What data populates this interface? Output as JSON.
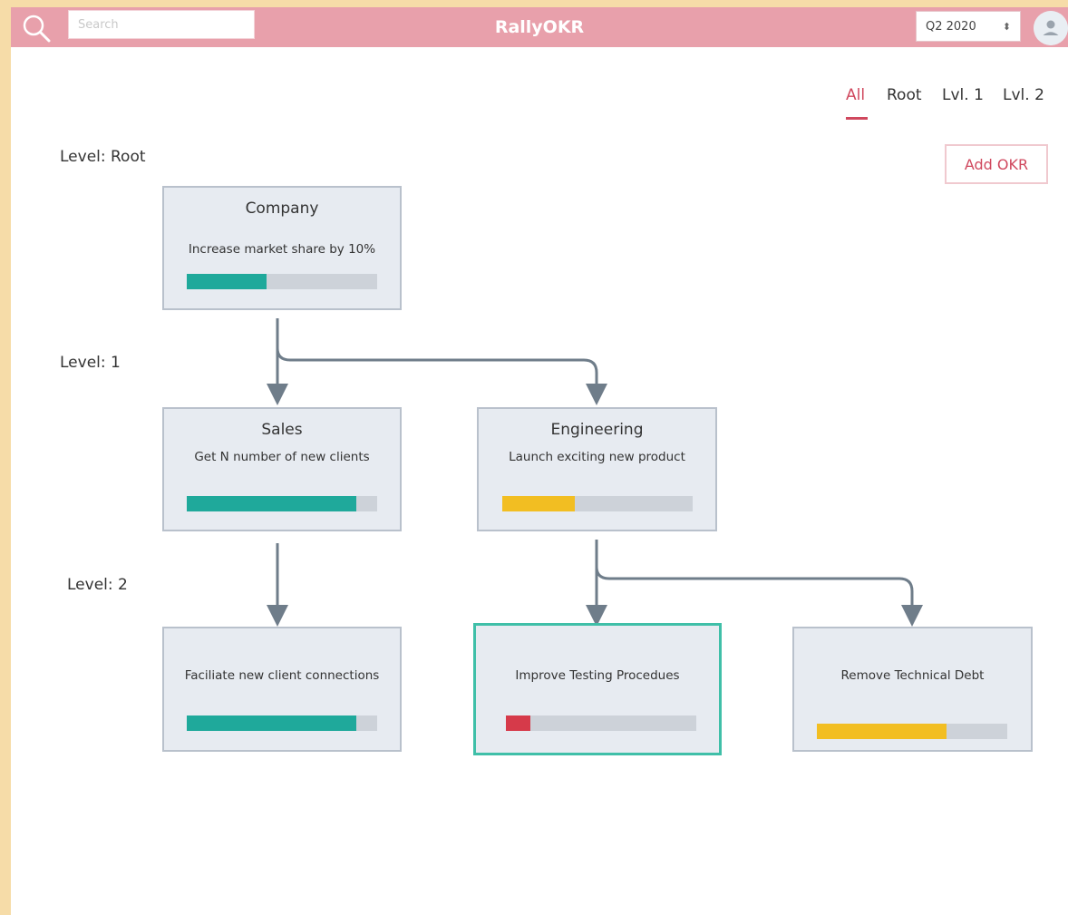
{
  "header": {
    "search_placeholder": "Search",
    "app_title": "RallyOKR",
    "quarter": "Q2 2020",
    "accent_color": "#e8a0ab"
  },
  "filters": {
    "tabs": [
      {
        "label": "All",
        "active": true
      },
      {
        "label": "Root",
        "active": false
      },
      {
        "label": "Lvl. 1",
        "active": false
      },
      {
        "label": "Lvl. 2",
        "active": false
      }
    ]
  },
  "actions": {
    "add_okr_label": "Add OKR"
  },
  "levels": {
    "root": "Level: Root",
    "lvl1": "Level: 1",
    "lvl2": "Level: 2"
  },
  "colors": {
    "teal": "#1fa99b",
    "yellow": "#f2be22",
    "red": "#d63a4a",
    "track": "#cdd2d9"
  },
  "okrs": {
    "company": {
      "team": "Company",
      "objective": "Increase market share by 10%",
      "progress": 0.42,
      "status": "teal"
    },
    "sales": {
      "team": "Sales",
      "objective": "Get N number of new clients",
      "progress": 0.89,
      "status": "teal"
    },
    "engineering": {
      "team": "Engineering",
      "objective": "Launch exciting new product",
      "progress": 0.38,
      "status": "yellow"
    },
    "facilitate": {
      "team": "",
      "objective": "Faciliate new client connections",
      "progress": 0.89,
      "status": "teal"
    },
    "testing": {
      "team": "",
      "objective": "Improve Testing Procedues",
      "progress": 0.13,
      "status": "red",
      "selected": true
    },
    "techdebt": {
      "team": "",
      "objective": "Remove Technical Debt",
      "progress": 0.68,
      "status": "yellow"
    }
  }
}
